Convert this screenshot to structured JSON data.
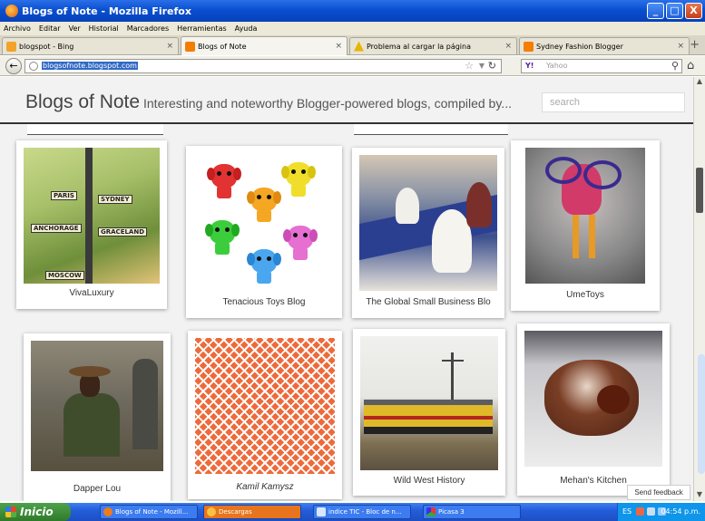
{
  "window": {
    "title": "Blogs of Note - Mozilla Firefox",
    "controls": {
      "minimize": "_",
      "maximize": "□",
      "close": "X"
    }
  },
  "menu": [
    "Archivo",
    "Editar",
    "Ver",
    "Historial",
    "Marcadores",
    "Herramientas",
    "Ayuda"
  ],
  "tabs": [
    {
      "label": "blogspot - Bing",
      "icon_color": "#f2a32b"
    },
    {
      "label": "Blogs of Note",
      "icon_color": "#f57d00"
    },
    {
      "label": "Problema al cargar la página",
      "icon_color": "#e8b400"
    },
    {
      "label": "Sydney Fashion Blogger",
      "icon_color": "#f57d00"
    }
  ],
  "nav": {
    "url": "blogsofnote.blogspot.com",
    "search_engine": "Y!",
    "search_placeholder": "Yahoo"
  },
  "blog": {
    "title": "Blogs of Note",
    "description": "Interesting and noteworthy Blogger-powered blogs, compiled by...",
    "search_placeholder": "search"
  },
  "cards": [
    {
      "caption": "VivaLuxury"
    },
    {
      "caption": "Tenacious Toys Blog"
    },
    {
      "caption": "The Global Small Business Blo"
    },
    {
      "caption": "UmeToys"
    },
    {
      "caption": "Dapper Lou"
    },
    {
      "caption": "Kamil Kamysz"
    },
    {
      "caption": "Wild West History"
    },
    {
      "caption": "Mehan's Kitchen"
    }
  ],
  "signs": [
    "PARIS",
    "SYDNEY",
    "ANCHORAGE",
    "GRACELAND",
    "MOSCOW"
  ],
  "feedback_label": "Send feedback",
  "taskbar": {
    "start_label": "Inicio",
    "tasks": [
      {
        "label": "Blogs of Note - Mozill...",
        "active": false
      },
      {
        "label": "Descargas",
        "active": true
      },
      {
        "label": "indice TIC - Bloc de n...",
        "active": false
      },
      {
        "label": "Picasa 3",
        "active": false
      }
    ],
    "tray_lang": "ES",
    "clock": "04:54 p.m."
  }
}
